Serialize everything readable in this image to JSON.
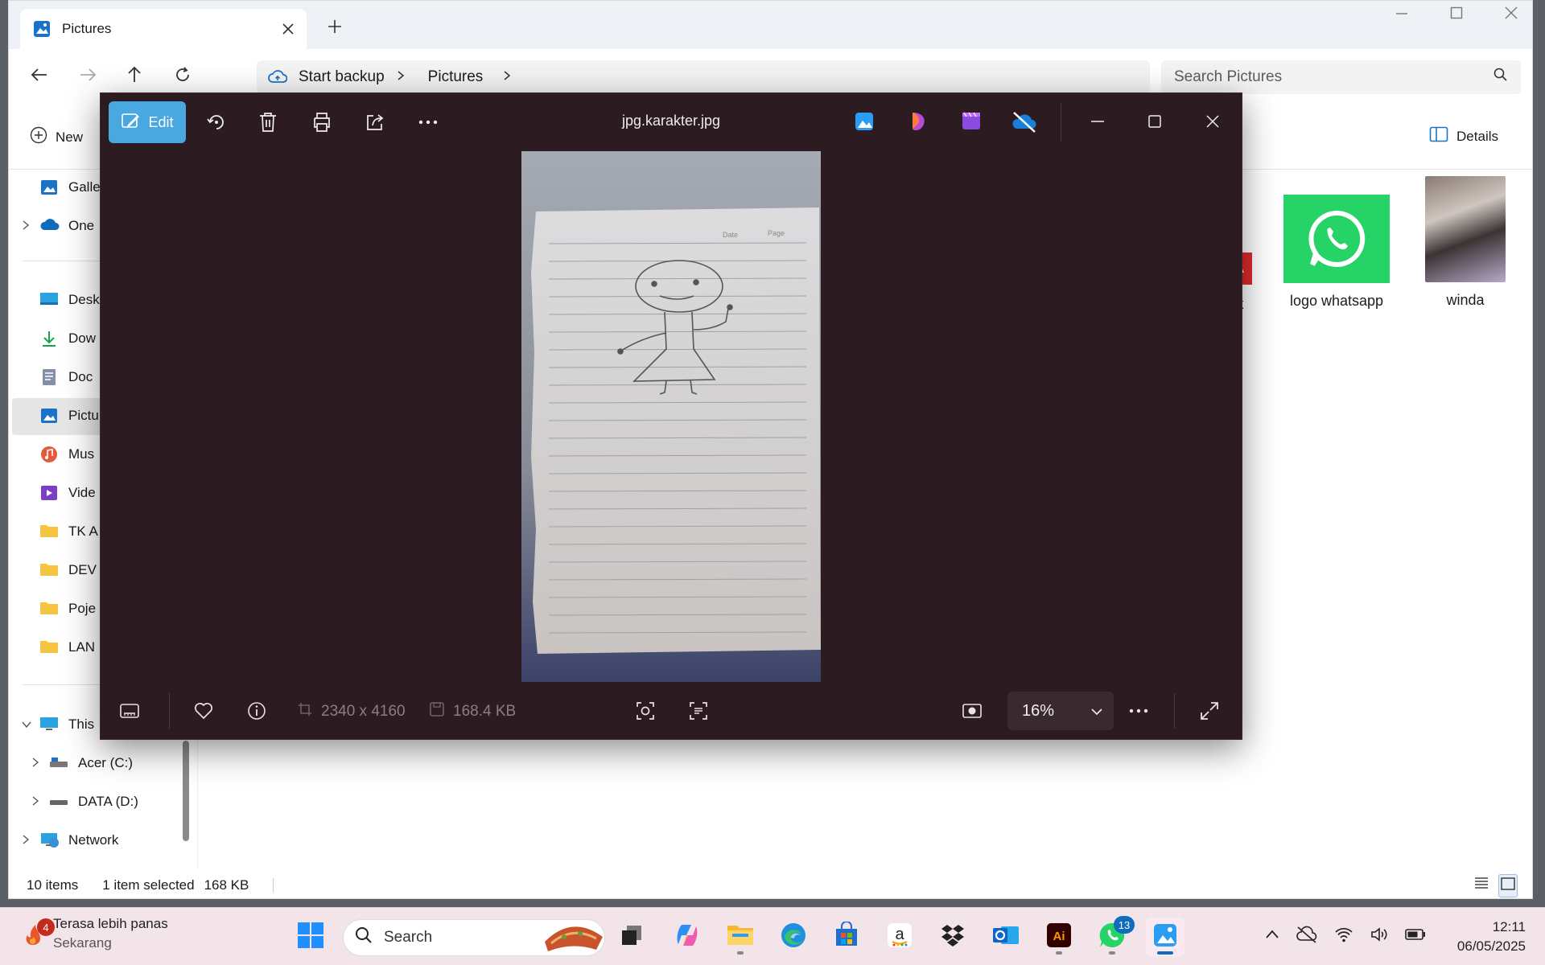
{
  "explorer": {
    "tab_title": "Pictures",
    "address": {
      "backup": "Start backup",
      "folder": "Pictures"
    },
    "search_placeholder": "Search Pictures",
    "command_bar": {
      "new_label": "New",
      "details_label": "Details"
    },
    "sidebar": {
      "items": [
        {
          "label": "Galle",
          "icon": "gallery-icon"
        },
        {
          "label": "One",
          "icon": "onedrive-icon"
        },
        {
          "label": "Desk",
          "icon": "desktop-icon"
        },
        {
          "label": "Dow",
          "icon": "downloads-icon"
        },
        {
          "label": "Doc",
          "icon": "documents-icon"
        },
        {
          "label": "Pictu",
          "icon": "pictures-icon"
        },
        {
          "label": "Mus",
          "icon": "music-icon"
        },
        {
          "label": "Vide",
          "icon": "videos-icon"
        },
        {
          "label": "TK A",
          "icon": "folder-icon"
        },
        {
          "label": "DEV",
          "icon": "folder-icon"
        },
        {
          "label": "Poje",
          "icon": "folder-icon"
        },
        {
          "label": "LAN",
          "icon": "folder-icon"
        },
        {
          "label": "This",
          "icon": "this-pc-icon"
        },
        {
          "label": "Acer (C:)",
          "icon": "drive-icon"
        },
        {
          "label": "DATA (D:)",
          "icon": "drive-icon"
        },
        {
          "label": "Network",
          "icon": "network-icon"
        }
      ]
    },
    "files": [
      {
        "name": "k"
      },
      {
        "name": "logo whatsapp"
      },
      {
        "name": "winda"
      }
    ],
    "status": {
      "count": "10 items",
      "selected": "1 item selected",
      "size": "168 KB"
    }
  },
  "viewer": {
    "edit_label": "Edit",
    "filename": "jpg.karakter.jpg",
    "image_paper_labels": {
      "date": "Date",
      "page": "Page"
    },
    "dimensions": "2340 x 4160",
    "file_size": "168.4 KB",
    "zoom": "16%"
  },
  "taskbar": {
    "weather": {
      "title": "Terasa lebih panas",
      "subtitle": "Sekarang",
      "badge": "4"
    },
    "search_label": "Search",
    "whatsapp_badge": "13",
    "clock": {
      "time": "12:11",
      "date": "06/05/2025"
    }
  },
  "colors": {
    "viewer_bg": "#2c1b20",
    "edit_accent": "#4aa8e0",
    "taskbar_bg": "#f3e4ea",
    "whatsapp_green": "#25d366"
  }
}
